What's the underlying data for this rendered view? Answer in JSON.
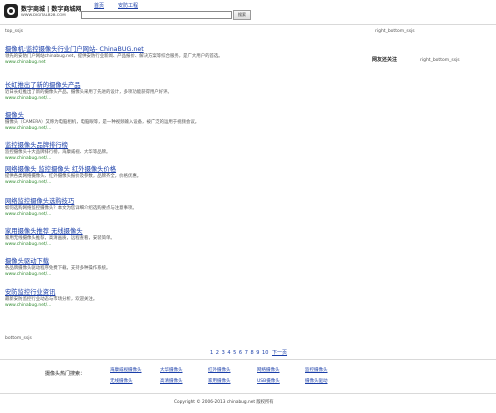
{
  "header": {
    "logo_text": "数字商城 | 数字商城网",
    "logo_sub": "WWW.DIGITALB2B.COM",
    "nav": [
      "首页",
      "安防工程"
    ],
    "search_value": "",
    "search_button": "搜索"
  },
  "ad_labels": {
    "top_left": "top_ssjs",
    "right_top": "right_bottom_ssjs",
    "right_a": "网友还关注",
    "right_b": "right_bottom_ssjs",
    "bottom": "bottom_ssjs"
  },
  "results": [
    {
      "title": "摄像机:监控摄像头行业门户网站- ChinaBUG.net",
      "desc": "领先的安防门户网站chinabug.net，提供安防行业新闻、产品报价、解决方案等综合服务，是广大用户的首选。",
      "url": "www.chinabug.net"
    },
    {
      "title": "长虹推出了新的摄像头产品",
      "desc": "近日长虹推出了新的摄像头产品。摄像头采用了先进的设计，多项功能获得用户好评。",
      "url": "www.chinabug.net/..."
    },
    {
      "title": "摄像头",
      "desc": "摄像头（CAMERA）又称为电脑相机，电脑眼等，是一种视频输入设备，被广泛的运用于视频会议。",
      "url": "www.chinabug.net/..."
    },
    {
      "title": "监控摄像头品牌排行榜",
      "desc": "监控摄像头十大品牌排行榜，海康威视、大华等品牌。",
      "url": "www.chinabug.net/..."
    },
    {
      "title": "网络摄像头 监控摄像头 红外摄像头价格",
      "desc": "提供各类网络摄像头、红外摄像头报价及参数，品牌齐全，价格优惠。",
      "url": "www.chinabug.net/..."
    },
    {
      "title": "网络监控摄像头选购技巧",
      "desc": "如何选购网络监控摄像头？本文为您详细介绍选购要点与注意事项。",
      "url": "www.chinabug.net/..."
    },
    {
      "title": "家用摄像头推荐 无线摄像头",
      "desc": "家用无线摄像头推荐，高清画质，远程查看，安装简单。",
      "url": "www.chinabug.net/..."
    },
    {
      "title": "摄像头驱动下载",
      "desc": "各品牌摄像头驱动程序免费下载，支持多种操作系统。",
      "url": "www.chinabug.net/..."
    },
    {
      "title": "安防监控行业资讯",
      "desc": "最新安防监控行业动态与市场分析，欢迎关注。",
      "url": "www.chinabug.net/..."
    }
  ],
  "pager": {
    "pages": [
      "1",
      "2",
      "3",
      "4",
      "5",
      "6",
      "7",
      "8",
      "9",
      "10"
    ],
    "next": "下一页"
  },
  "footer": {
    "label": "摄像头热门搜索：",
    "links": [
      "海康威视摄像头",
      "大华摄像头",
      "红外摄像头",
      "网络摄像头",
      "监控摄像头",
      "无线摄像头",
      "高清摄像头",
      "家用摄像头",
      "USB摄像头",
      "摄像头驱动"
    ],
    "copyright": "Copyright © 2006-2013 chinabug.net 版权所有"
  }
}
